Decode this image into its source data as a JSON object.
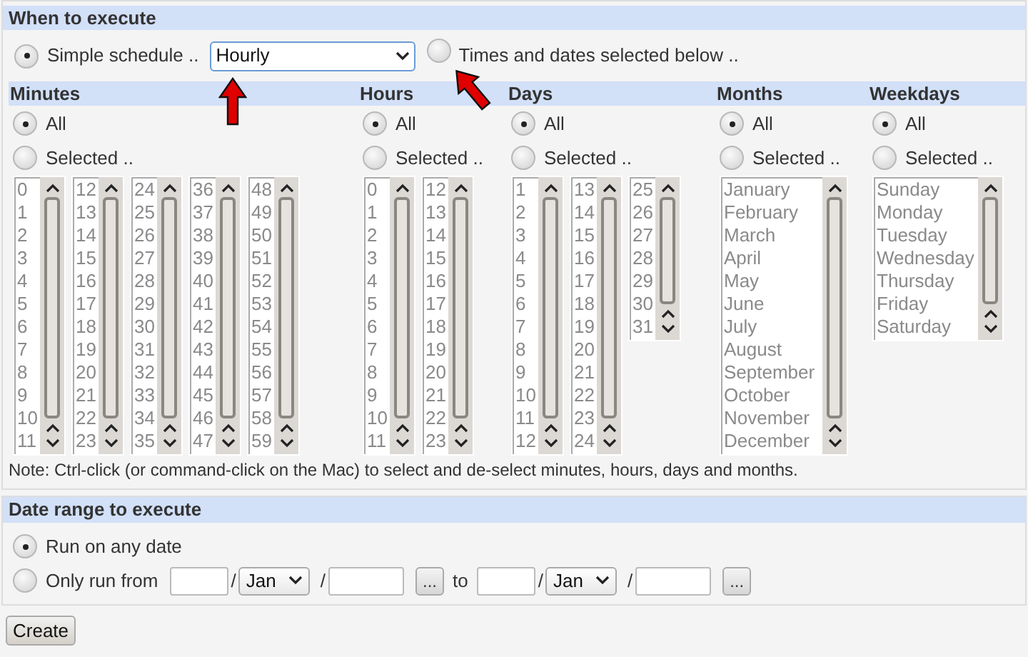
{
  "when_to_execute": {
    "title": "When to execute",
    "simple_schedule": {
      "label": "Simple schedule ..",
      "selected": true
    },
    "schedule_select": {
      "value": "Hourly"
    },
    "times_option": {
      "label": "Times and dates selected below ..",
      "selected": false
    },
    "groups": [
      {
        "title": "Minutes",
        "all": {
          "label": "All",
          "selected": true
        },
        "selected_option": {
          "label": "Selected ..",
          "selected": false
        },
        "disabled": true,
        "lists": [
          [
            "0",
            "1",
            "2",
            "3",
            "4",
            "5",
            "6",
            "7",
            "8",
            "9",
            "10",
            "11"
          ],
          [
            "12",
            "13",
            "14",
            "15",
            "16",
            "17",
            "18",
            "19",
            "20",
            "21",
            "22",
            "23"
          ],
          [
            "24",
            "25",
            "26",
            "27",
            "28",
            "29",
            "30",
            "31",
            "32",
            "33",
            "34",
            "35"
          ],
          [
            "36",
            "37",
            "38",
            "39",
            "40",
            "41",
            "42",
            "43",
            "44",
            "45",
            "46",
            "47"
          ],
          [
            "48",
            "49",
            "50",
            "51",
            "52",
            "53",
            "54",
            "55",
            "56",
            "57",
            "58",
            "59"
          ]
        ]
      },
      {
        "title": "Hours",
        "all": {
          "label": "All",
          "selected": true
        },
        "selected_option": {
          "label": "Selected ..",
          "selected": false
        },
        "disabled": true,
        "lists": [
          [
            "0",
            "1",
            "2",
            "3",
            "4",
            "5",
            "6",
            "7",
            "8",
            "9",
            "10",
            "11"
          ],
          [
            "12",
            "13",
            "14",
            "15",
            "16",
            "17",
            "18",
            "19",
            "20",
            "21",
            "22",
            "23"
          ]
        ]
      },
      {
        "title": "Days",
        "all": {
          "label": "All",
          "selected": true
        },
        "selected_option": {
          "label": "Selected ..",
          "selected": false
        },
        "disabled": true,
        "lists": [
          [
            "1",
            "2",
            "3",
            "4",
            "5",
            "6",
            "7",
            "8",
            "9",
            "10",
            "11",
            "12"
          ],
          [
            "13",
            "14",
            "15",
            "16",
            "17",
            "18",
            "19",
            "20",
            "21",
            "22",
            "23",
            "24"
          ],
          [
            "25",
            "26",
            "27",
            "28",
            "29",
            "30",
            "31"
          ]
        ]
      },
      {
        "title": "Months",
        "all": {
          "label": "All",
          "selected": true
        },
        "selected_option": {
          "label": "Selected ..",
          "selected": false
        },
        "disabled": true,
        "lists": [
          [
            "January",
            "February",
            "March",
            "April",
            "May",
            "June",
            "July",
            "August",
            "September",
            "October",
            "November",
            "December"
          ]
        ]
      },
      {
        "title": "Weekdays",
        "all": {
          "label": "All",
          "selected": true
        },
        "selected_option": {
          "label": "Selected ..",
          "selected": false
        },
        "disabled": true,
        "lists": [
          [
            "Sunday",
            "Monday",
            "Tuesday",
            "Wednesday",
            "Thursday",
            "Friday",
            "Saturday"
          ]
        ]
      }
    ],
    "note": "Note: Ctrl-click (or command-click on the Mac) to select and de-select minutes, hours, days and months."
  },
  "date_range": {
    "title": "Date range to execute",
    "any_date": {
      "label": "Run on any date",
      "selected": true
    },
    "only_run": {
      "label": "Only run from",
      "selected": false
    },
    "from": {
      "separators": [
        "/",
        "/"
      ],
      "month": "Jan",
      "picker": "..."
    },
    "to_label": "to",
    "to": {
      "separators": [
        "/",
        "/"
      ],
      "month": "Jan",
      "picker": "..."
    }
  },
  "create_button": "Create"
}
